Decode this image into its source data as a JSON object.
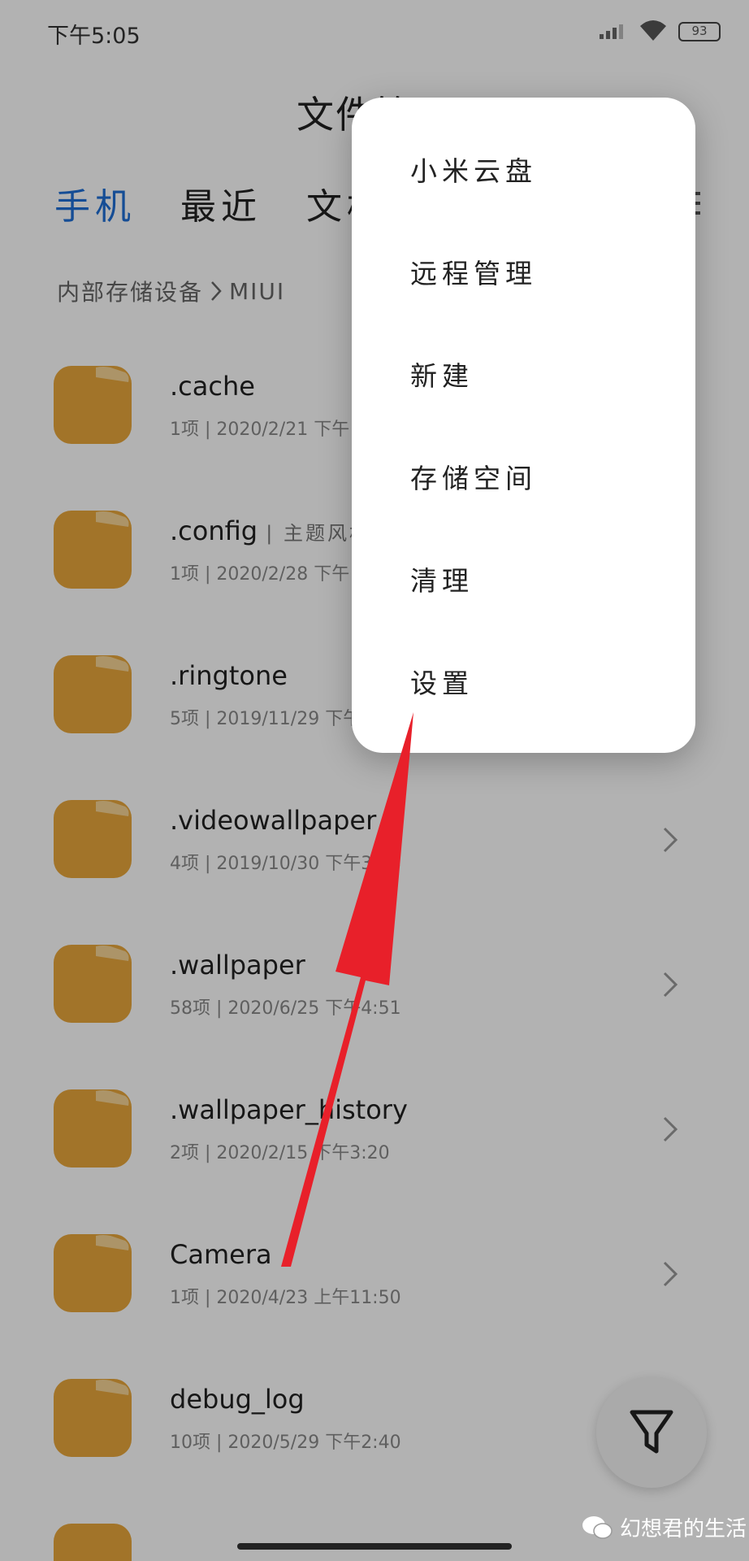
{
  "status_bar": {
    "time": "下午5:05",
    "battery": "93"
  },
  "header": {
    "title": "文件管理",
    "tabs": [
      {
        "label": "手机",
        "active": true
      },
      {
        "label": "最近",
        "active": false
      },
      {
        "label": "文档",
        "active": false
      }
    ]
  },
  "breadcrumb": {
    "root": "内部存储设备",
    "current": "MIUI"
  },
  "files": [
    {
      "name": ".cache",
      "tag": "",
      "meta": "1项 | 2020/2/21 下午"
    },
    {
      "name": ".config",
      "tag": "主题风格",
      "meta": "1项 | 2020/2/28 下午"
    },
    {
      "name": ".ringtone",
      "tag": "",
      "meta": "5项 | 2019/11/29 下午"
    },
    {
      "name": ".videowallpaper",
      "tag": "",
      "meta": "4项 | 2019/10/30 下午3:28"
    },
    {
      "name": ".wallpaper",
      "tag": "",
      "meta": "58项 | 2020/6/25 下午4:51"
    },
    {
      "name": ".wallpaper_history",
      "tag": "",
      "meta": "2项 | 2020/2/15 下午3:20"
    },
    {
      "name": "Camera",
      "tag": "",
      "meta": "1项 | 2020/4/23 上午11:50"
    },
    {
      "name": "debug_log",
      "tag": "",
      "meta": "10项 | 2020/5/29 下午2:40"
    }
  ],
  "popup_menu": {
    "items": [
      {
        "label": "小米云盘"
      },
      {
        "label": "远程管理"
      },
      {
        "label": "新建"
      },
      {
        "label": "存储空间"
      },
      {
        "label": "清理"
      },
      {
        "label": "设置"
      }
    ]
  },
  "watermark": {
    "text": "幻想君的生活"
  },
  "colors": {
    "accent": "#1f6fd6",
    "folder": "#e8a73c",
    "arrow": "#e8202a"
  },
  "icons": {
    "folder": "folder-icon",
    "chevron": "chevron-right-icon",
    "filter": "filter-icon",
    "wifi": "wifi-icon",
    "signal": "signal-icon",
    "battery": "battery-icon"
  }
}
